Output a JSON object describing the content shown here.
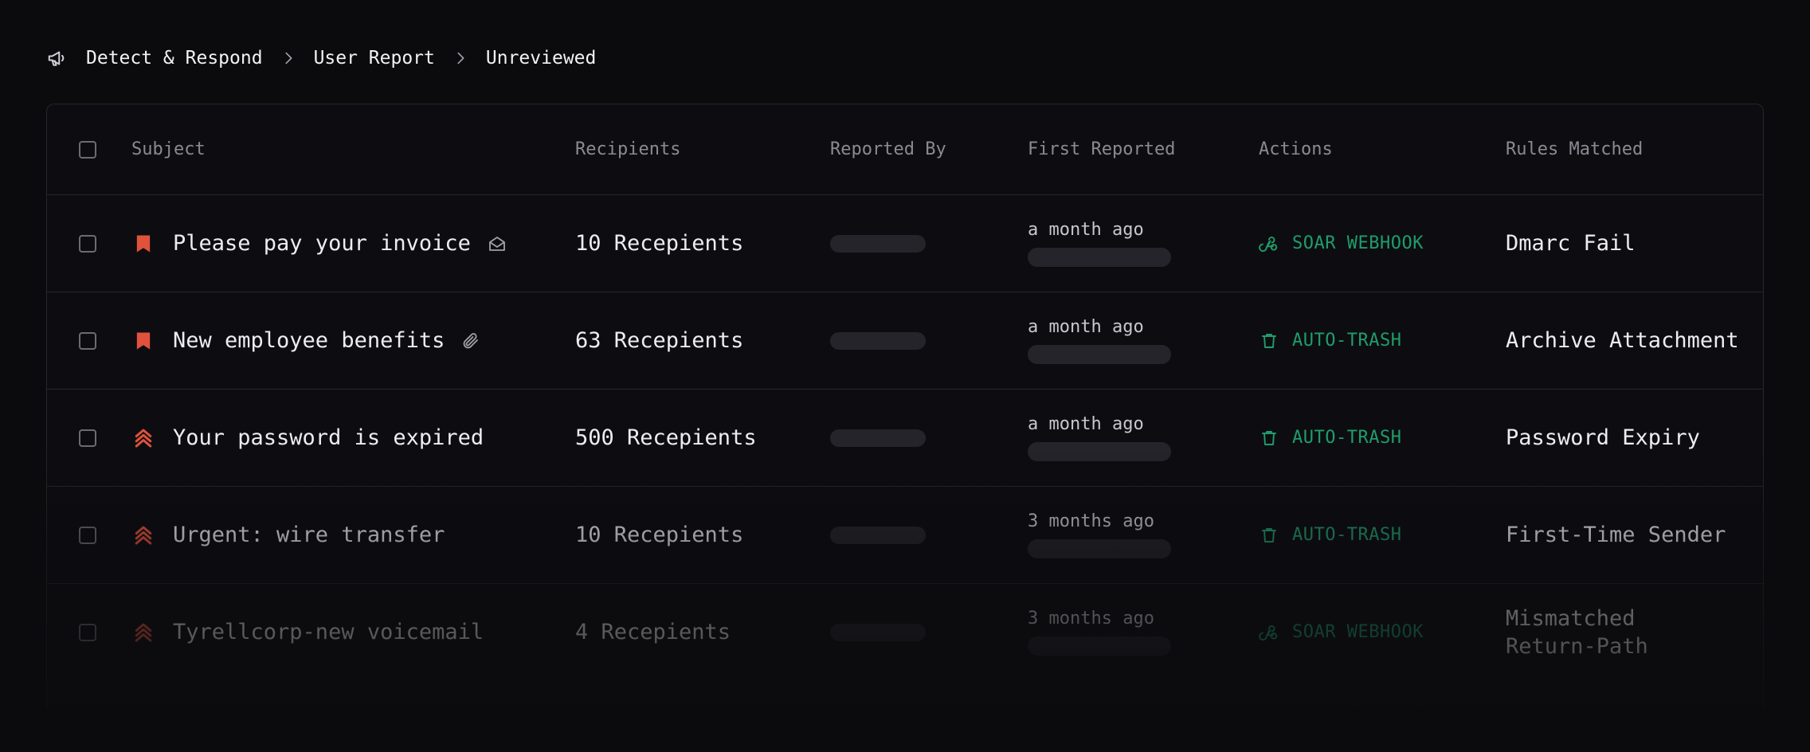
{
  "breadcrumb": {
    "icon": "megaphone-icon",
    "items": [
      "Detect & Respond",
      "User Report",
      "Unreviewed"
    ]
  },
  "table": {
    "columns": {
      "subject": "Subject",
      "recipients": "Recipients",
      "reported_by": "Reported By",
      "first_reported": "First Reported",
      "actions": "Actions",
      "rules_matched": "Rules Matched"
    },
    "rows": [
      {
        "subject": "Please pay your invoice",
        "severity_icon": "flag-icon",
        "subject_icon": "envelope-open-icon",
        "recipients": "10 Recepients",
        "first_reported": "a month ago",
        "action_icon": "webhook-icon",
        "action": "SOAR WEBHOOK",
        "rule": "Dmarc Fail"
      },
      {
        "subject": "New employee benefits",
        "severity_icon": "flag-icon",
        "subject_icon": "paperclip-icon",
        "recipients": "63 Recepients",
        "first_reported": "a month ago",
        "action_icon": "trash-icon",
        "action": "AUTO-TRASH",
        "rule": "Archive Attachment"
      },
      {
        "subject": "Your password is expired",
        "severity_icon": "triple-chevron-up-icon",
        "recipients": "500 Recepients",
        "first_reported": "a month ago",
        "action_icon": "trash-icon",
        "action": "AUTO-TRASH",
        "rule": "Password Expiry"
      },
      {
        "subject": "Urgent: wire transfer",
        "severity_icon": "triple-chevron-up-icon",
        "recipients": "10 Recepients",
        "first_reported": "3 months ago",
        "action_icon": "trash-icon",
        "action": "AUTO-TRASH",
        "rule": "First-Time Sender"
      },
      {
        "subject": "Tyrellcorp-new voicemail",
        "severity_icon": "triple-chevron-up-icon",
        "recipients": "4 Recepients",
        "first_reported": "3 months ago",
        "action_icon": "webhook-icon",
        "action": "SOAR WEBHOOK",
        "rule": "Mismatched\nReturn-Path"
      }
    ]
  },
  "colors": {
    "severity": "#e0523c",
    "action": "#1f9d6a",
    "background": "#0b0b0e",
    "border": "#26262b"
  }
}
